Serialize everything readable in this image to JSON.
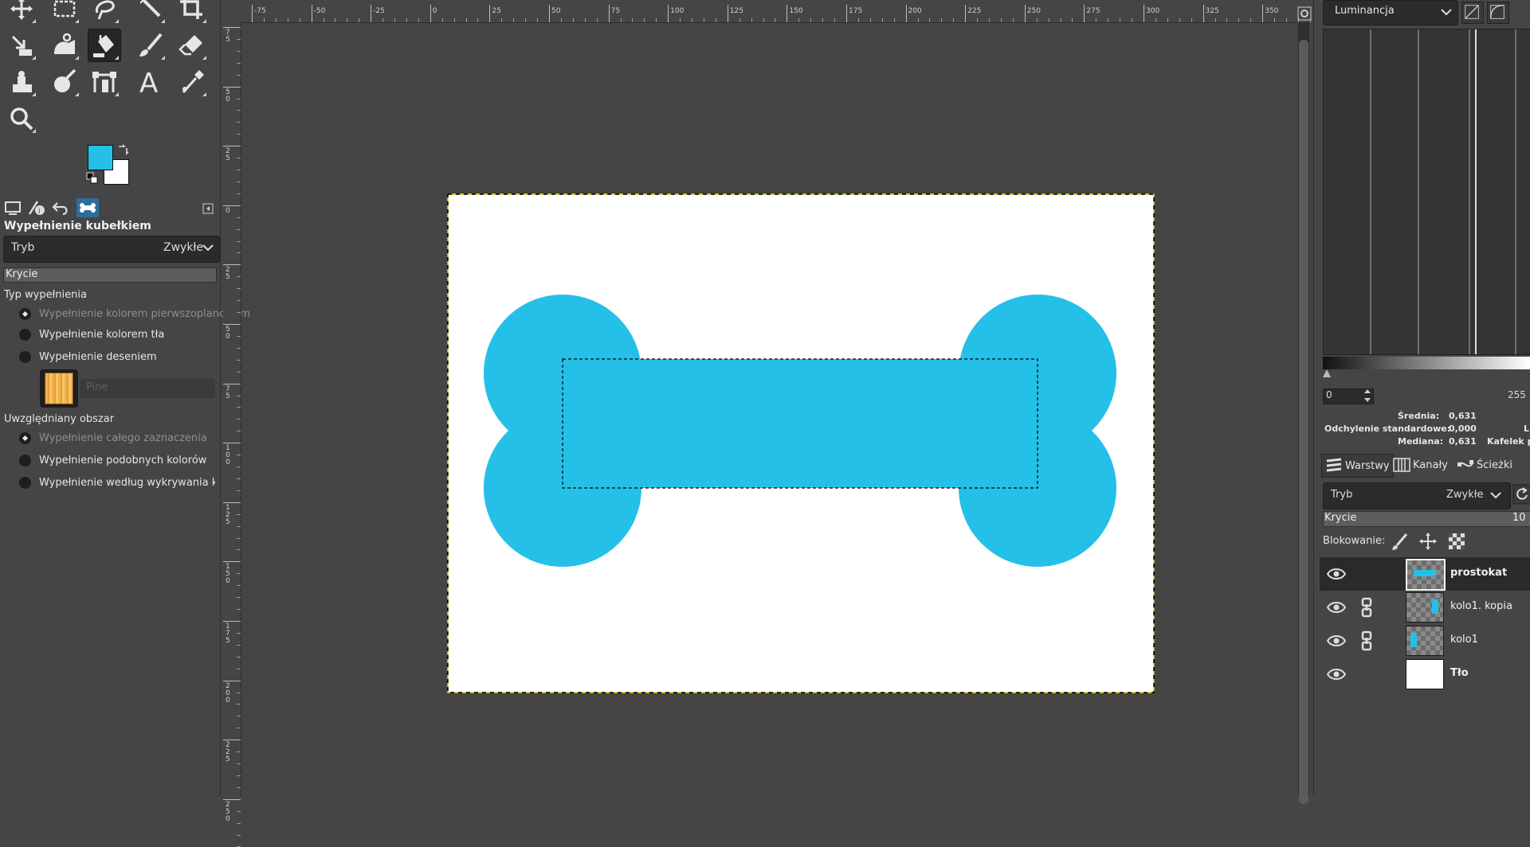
{
  "tools": [
    {
      "icon": "move-tool-icon"
    },
    {
      "icon": "rect-select-tool-icon"
    },
    {
      "icon": "free-select-tool-icon"
    },
    {
      "icon": "fuzzy-select-tool-icon"
    },
    {
      "icon": "crop-tool-icon"
    },
    {
      "icon": "unified-transform-tool-icon"
    },
    {
      "icon": "warp-transform-tool-icon"
    },
    {
      "icon": "bucket-fill-tool-icon",
      "active": true
    },
    {
      "icon": "paintbrush-tool-icon"
    },
    {
      "icon": "eraser-tool-icon"
    },
    {
      "icon": "clone-tool-icon"
    },
    {
      "icon": "smudge-tool-icon"
    },
    {
      "icon": "paths-tool-icon"
    },
    {
      "icon": "text-tool-icon"
    },
    {
      "icon": "color-picker-tool-icon"
    },
    {
      "icon": "zoom-tool-icon"
    }
  ],
  "colors": {
    "foreground": "#25c0e8",
    "background": "#ffffff"
  },
  "tool_options": {
    "title": "Wypełnienie kubełkiem",
    "mode_label": "Tryb",
    "mode_value": "Zwykłe",
    "opacity_label": "Krycie",
    "fill_type_label": "Typ wypełnienia",
    "fill_types": [
      {
        "label": "Wypełnienie kolorem pierwszoplanowym",
        "selected": true
      },
      {
        "label": "Wypełnienie kolorem tła",
        "selected": false
      },
      {
        "label": "Wypełnienie deseniem",
        "selected": false
      }
    ],
    "pattern_name": "Pine",
    "area_label": "Uwzględniany obszar",
    "areas": [
      {
        "label": "Wypełnienie całego zaznaczenia",
        "selected": true
      },
      {
        "label": "Wypełnienie podobnych kolorów",
        "selected": false
      },
      {
        "label": "Wypełnienie według wykrywania krawędzi",
        "selected": false
      }
    ]
  },
  "ruler_top": [
    "-75",
    "-50",
    "-25",
    "0",
    "25",
    "50",
    "75",
    "100",
    "125",
    "150",
    "175",
    "200",
    "225",
    "250",
    "275",
    "300",
    "325",
    "350"
  ],
  "ruler_left": [
    "75",
    "50",
    "25",
    "0",
    "25",
    "50",
    "75",
    "100",
    "125",
    "150",
    "175",
    "200",
    "225",
    "250"
  ],
  "canvas": {
    "bone_color": "#25c0e8"
  },
  "histogram": {
    "channel": "Luminancja",
    "range_min": "0",
    "range_max": "255",
    "mean_label": "Średnia:",
    "mean_value": "0,631",
    "std_label": "Odchylenie standardowe:",
    "std_value": "0,000",
    "median_label": "Mediana:",
    "median_value": "0,631",
    "right_cut1": "L",
    "right_cut2": "Kafelek p"
  },
  "dock_tabs": {
    "layers": "Warstwy",
    "channels": "Kanały",
    "paths": "Ścieżki"
  },
  "layers_panel": {
    "mode_label": "Tryb",
    "mode_value": "Zwykłe",
    "opacity_label": "Krycie",
    "opacity_value": "10",
    "lock_label": "Blokowanie:"
  },
  "layers": [
    {
      "name": "prostokat",
      "selected": true
    },
    {
      "name": "kolo1. kopia",
      "selected": false
    },
    {
      "name": "kolo1",
      "selected": false
    },
    {
      "name": "Tło",
      "selected": false
    }
  ]
}
